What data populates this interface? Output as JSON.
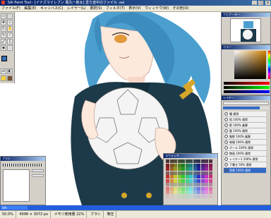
{
  "window": {
    "title": "SAI Paint Tool - [イナズマイレブン 風丸一郎太] 塗り途中のファイル .sai",
    "minimize": "_",
    "maximize": "□",
    "close": "×"
  },
  "menu": {
    "items": [
      "ファイル(F)",
      "編集(E)",
      "キャンバス(C)",
      "レイヤー(L)",
      "選択(S)",
      "フィルタ(T)",
      "表示(V)",
      "ウィンドウ(W)",
      "その他(O)"
    ]
  },
  "panels": {
    "navigator_title": "ナビゲーター",
    "color_title": "カラー",
    "layers_title": "レイヤー",
    "swatch_title": "スウォッチ",
    "brush_title": "ブラシ"
  },
  "layers": [
    {
      "name": "瞳",
      "mode": "通常"
    },
    {
      "name": "肌",
      "mode": "100% 通常"
    },
    {
      "name": "影",
      "mode": "100% 乗算"
    },
    {
      "name": "髪",
      "mode": "100% 通常"
    },
    {
      "name": "髪影",
      "mode": "100% 乗算"
    },
    {
      "name": "制服",
      "mode": "100% 通常"
    },
    {
      "name": "ボール",
      "mode": "100% 通常"
    },
    {
      "name": "線画",
      "mode": "100% 通常"
    },
    {
      "name": "レイヤー1",
      "mode": "100% 通常"
    },
    {
      "name": "下書き",
      "mode": "50% 通常"
    },
    {
      "name": "背景",
      "mode": "100% 通常"
    }
  ],
  "status": {
    "zoom": "50.0%",
    "position": "4096 × 3072 px",
    "memory": "メモリ使用量 22%",
    "tool": "ブラシ",
    "pressure": "筆圧"
  },
  "taskbar": {
    "button": "SAI"
  },
  "colors": {
    "hair": "#4b9fcf",
    "uniform": "#1d3a4a",
    "skin": "#fde8dc",
    "current_fg": "#3b6fb6",
    "current_bg": "#ffffff"
  }
}
